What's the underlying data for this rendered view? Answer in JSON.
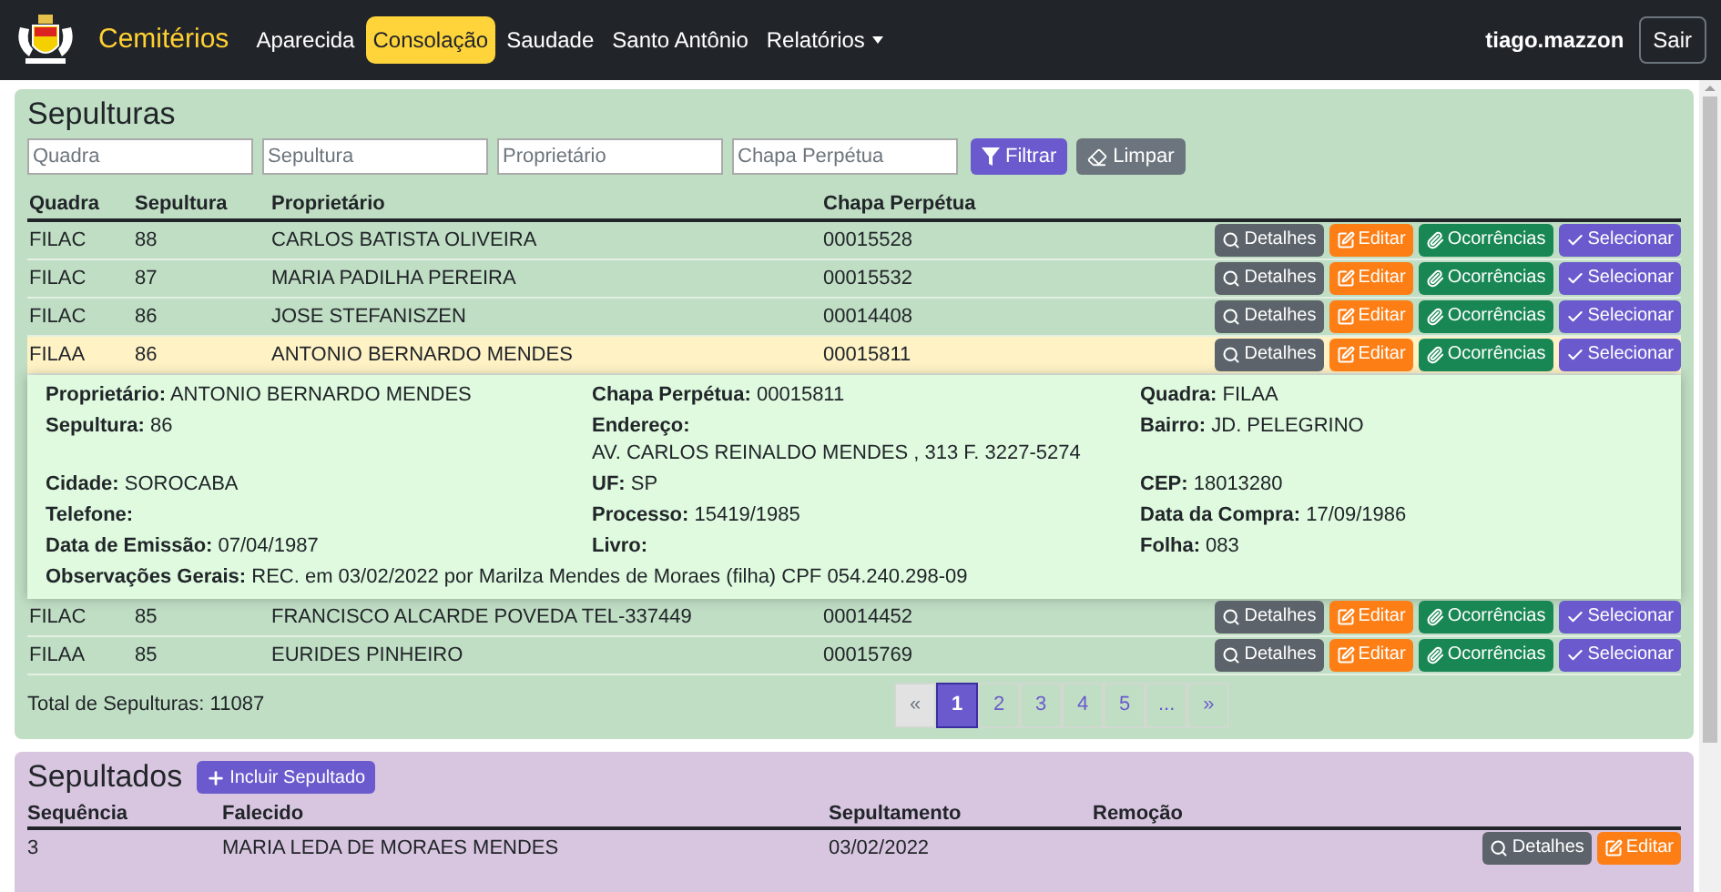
{
  "navbar": {
    "brand": "Cemitérios",
    "items": [
      {
        "label": "Aparecida",
        "selected": false,
        "kind": "link"
      },
      {
        "label": "Consolação",
        "selected": true,
        "kind": "link"
      },
      {
        "label": "Saudade",
        "selected": false,
        "kind": "link"
      },
      {
        "label": "Santo Antônio",
        "selected": false,
        "kind": "link"
      },
      {
        "label": "Relatórios",
        "selected": false,
        "kind": "dropdown"
      }
    ],
    "user": "tiago.mazzon",
    "logout": "Sair"
  },
  "sepulturas": {
    "title": "Sepulturas",
    "filters": [
      {
        "placeholder": "Quadra"
      },
      {
        "placeholder": "Sepultura"
      },
      {
        "placeholder": "Proprietário"
      },
      {
        "placeholder": "Chapa Perpétua"
      }
    ],
    "filter_button": "Filtrar",
    "clear_button": "Limpar",
    "columns": [
      "Quadra",
      "Sepultura",
      "Proprietário",
      "Chapa Perpétua"
    ],
    "rows": [
      {
        "cells": [
          "FILAC",
          "88",
          "CARLOS BATISTA OLIVEIRA",
          "00015528"
        ],
        "selected": false,
        "actions": [
          {
            "kind": "details",
            "label": "Detalhes"
          },
          {
            "kind": "edit",
            "label": "Editar"
          },
          {
            "kind": "occurrences",
            "label": "Ocorrências"
          },
          {
            "kind": "select",
            "label": "Selecionar"
          }
        ]
      },
      {
        "cells": [
          "FILAC",
          "87",
          "MARIA PADILHA PEREIRA",
          "00015532"
        ],
        "selected": false,
        "actions": [
          {
            "kind": "details",
            "label": "Detalhes"
          },
          {
            "kind": "edit",
            "label": "Editar"
          },
          {
            "kind": "occurrences",
            "label": "Ocorrências"
          },
          {
            "kind": "select",
            "label": "Selecionar"
          }
        ]
      },
      {
        "cells": [
          "FILAC",
          "86",
          "JOSE STEFANISZEN",
          "00014408"
        ],
        "selected": false,
        "actions": [
          {
            "kind": "details",
            "label": "Detalhes"
          },
          {
            "kind": "edit",
            "label": "Editar"
          },
          {
            "kind": "occurrences",
            "label": "Ocorrências"
          },
          {
            "kind": "select",
            "label": "Selecionar"
          }
        ]
      },
      {
        "cells": [
          "FILAA",
          "86",
          "ANTONIO BERNARDO MENDES",
          "00015811"
        ],
        "selected": true,
        "expanded": true,
        "actions": [
          {
            "kind": "details",
            "label": "Detalhes"
          },
          {
            "kind": "edit",
            "label": "Editar"
          },
          {
            "kind": "occurrences",
            "label": "Ocorrências"
          },
          {
            "kind": "select",
            "label": "Selecionar"
          }
        ],
        "details": [
          {
            "kind": "inline",
            "label": "Proprietário:",
            "value": "ANTONIO BERNARDO MENDES"
          },
          {
            "kind": "inline",
            "label": "Chapa Perpétua:",
            "value": "00015811"
          },
          {
            "kind": "inline",
            "label": "Quadra:",
            "value": "FILAA"
          },
          {
            "kind": "inline",
            "label": "Sepultura:",
            "value": "86"
          },
          {
            "kind": "block",
            "label": "Endereço:",
            "value": "AV. CARLOS REINALDO MENDES , 313 F. 3227-5274"
          },
          {
            "kind": "inline",
            "label": "Bairro:",
            "value": "JD. PELEGRINO"
          },
          {
            "kind": "inline",
            "label": "Cidade:",
            "value": "SOROCABA"
          },
          {
            "kind": "inline",
            "label": "UF:",
            "value": "SP"
          },
          {
            "kind": "inline",
            "label": "CEP:",
            "value": "18013280"
          },
          {
            "kind": "inline",
            "label": "Telefone:"
          },
          {
            "kind": "inline",
            "label": "Processo:",
            "value": "15419/1985"
          },
          {
            "kind": "inline",
            "label": "Data da Compra:",
            "value": "17/09/1986"
          },
          {
            "kind": "inline",
            "label": "Data de Emissão:",
            "value": "07/04/1987"
          },
          {
            "kind": "inline",
            "label": "Livro:"
          },
          {
            "kind": "inline",
            "label": "Folha:",
            "value": "083"
          },
          {
            "kind": "wide",
            "label": "Observações Gerais:",
            "value": "REC. em 03/02/2022 por Marilza Mendes de Moraes (filha) CPF 054.240.298-09"
          }
        ]
      },
      {
        "cells": [
          "FILAC",
          "85",
          "FRANCISCO ALCARDE POVEDA TEL-337449",
          "00014452"
        ],
        "selected": false,
        "actions": [
          {
            "kind": "details",
            "label": "Detalhes"
          },
          {
            "kind": "edit",
            "label": "Editar"
          },
          {
            "kind": "occurrences",
            "label": "Ocorrências"
          },
          {
            "kind": "select",
            "label": "Selecionar"
          }
        ]
      },
      {
        "cells": [
          "FILAA",
          "85",
          "EURIDES PINHEIRO",
          "00015769"
        ],
        "selected": false,
        "actions": [
          {
            "kind": "details",
            "label": "Detalhes"
          },
          {
            "kind": "edit",
            "label": "Editar"
          },
          {
            "kind": "occurrences",
            "label": "Ocorrências"
          },
          {
            "kind": "select",
            "label": "Selecionar"
          }
        ]
      }
    ],
    "total": "Total de Sepulturas: 11087",
    "pagination": [
      {
        "label": "«",
        "selected": false,
        "disabled": true
      },
      {
        "label": "1",
        "selected": true,
        "disabled": false
      },
      {
        "label": "2",
        "selected": false,
        "disabled": false
      },
      {
        "label": "3",
        "selected": false,
        "disabled": false
      },
      {
        "label": "4",
        "selected": false,
        "disabled": false
      },
      {
        "label": "5",
        "selected": false,
        "disabled": false
      },
      {
        "label": "...",
        "selected": false,
        "disabled": false
      },
      {
        "label": "»",
        "selected": false,
        "disabled": false
      }
    ]
  },
  "sepultados": {
    "title": "Sepultados",
    "add_button": "Incluir Sepultado",
    "columns": [
      "Sequência",
      "Falecido",
      "Sepultamento",
      "Remoção"
    ],
    "rows": [
      {
        "cells": [
          "3",
          "MARIA LEDA DE MORAES MENDES",
          "03/02/2022"
        ],
        "actions": [
          {
            "kind": "details",
            "label": "Detalhes"
          },
          {
            "kind": "edit",
            "label": "Editar"
          }
        ]
      }
    ]
  }
}
